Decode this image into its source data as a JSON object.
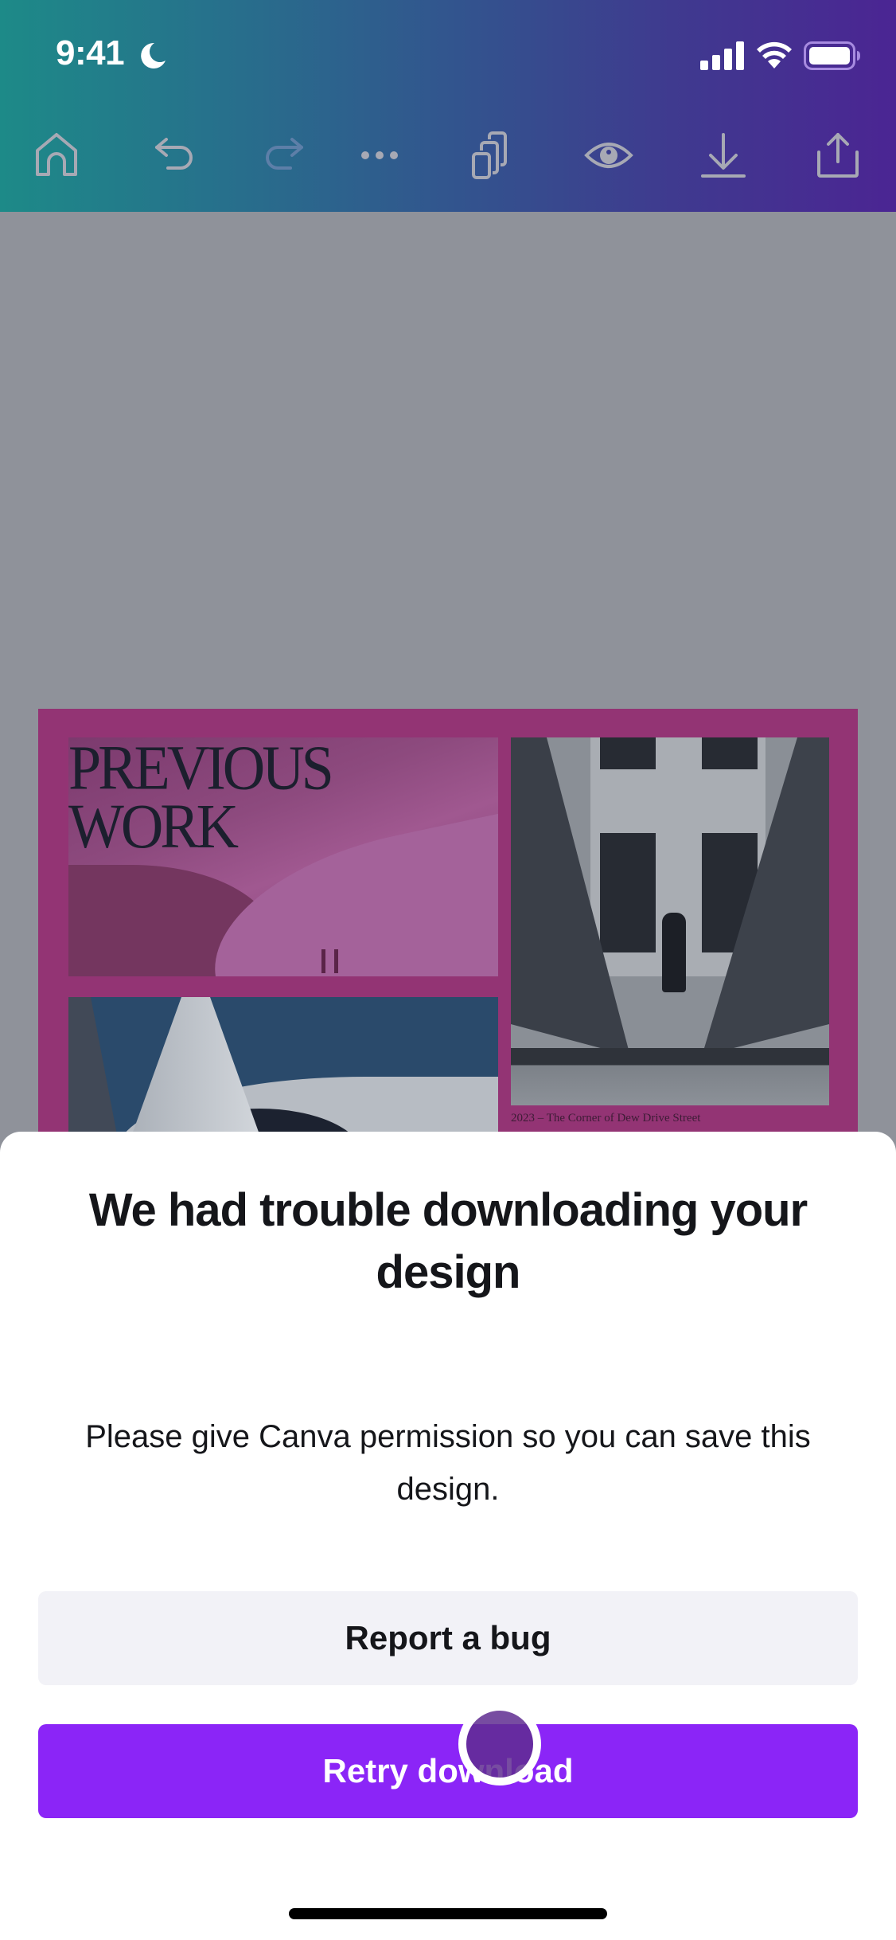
{
  "status_bar": {
    "time": "9:41",
    "focus_mode_icon": "moon-icon",
    "signal_icon": "cellular-signal-icon",
    "wifi_icon": "wifi-icon",
    "battery_icon": "battery-icon"
  },
  "toolbar": {
    "items": [
      {
        "name": "home",
        "icon": "home-icon",
        "enabled": true
      },
      {
        "name": "undo",
        "icon": "undo-icon",
        "enabled": true
      },
      {
        "name": "redo",
        "icon": "redo-icon",
        "enabled": false
      },
      {
        "name": "more",
        "icon": "more-icon",
        "enabled": true
      },
      {
        "name": "pages",
        "icon": "pages-icon",
        "enabled": true
      },
      {
        "name": "preview",
        "icon": "eye-icon",
        "enabled": true
      },
      {
        "name": "download",
        "icon": "download-icon",
        "enabled": true
      },
      {
        "name": "share",
        "icon": "share-icon",
        "enabled": true
      }
    ]
  },
  "design": {
    "title_line1": "PREVIOUS",
    "title_line2": "WORK",
    "caption": "2023 – The Corner of Dew Drive Street",
    "background_color": "#933474"
  },
  "dialog": {
    "title": "We had trouble downloading your design",
    "message": "Please give Canva permission so you can save this design.",
    "secondary_button": "Report a bug",
    "primary_button": "Retry download",
    "primary_color": "#8b25f7",
    "secondary_color": "#f2f2f7"
  }
}
